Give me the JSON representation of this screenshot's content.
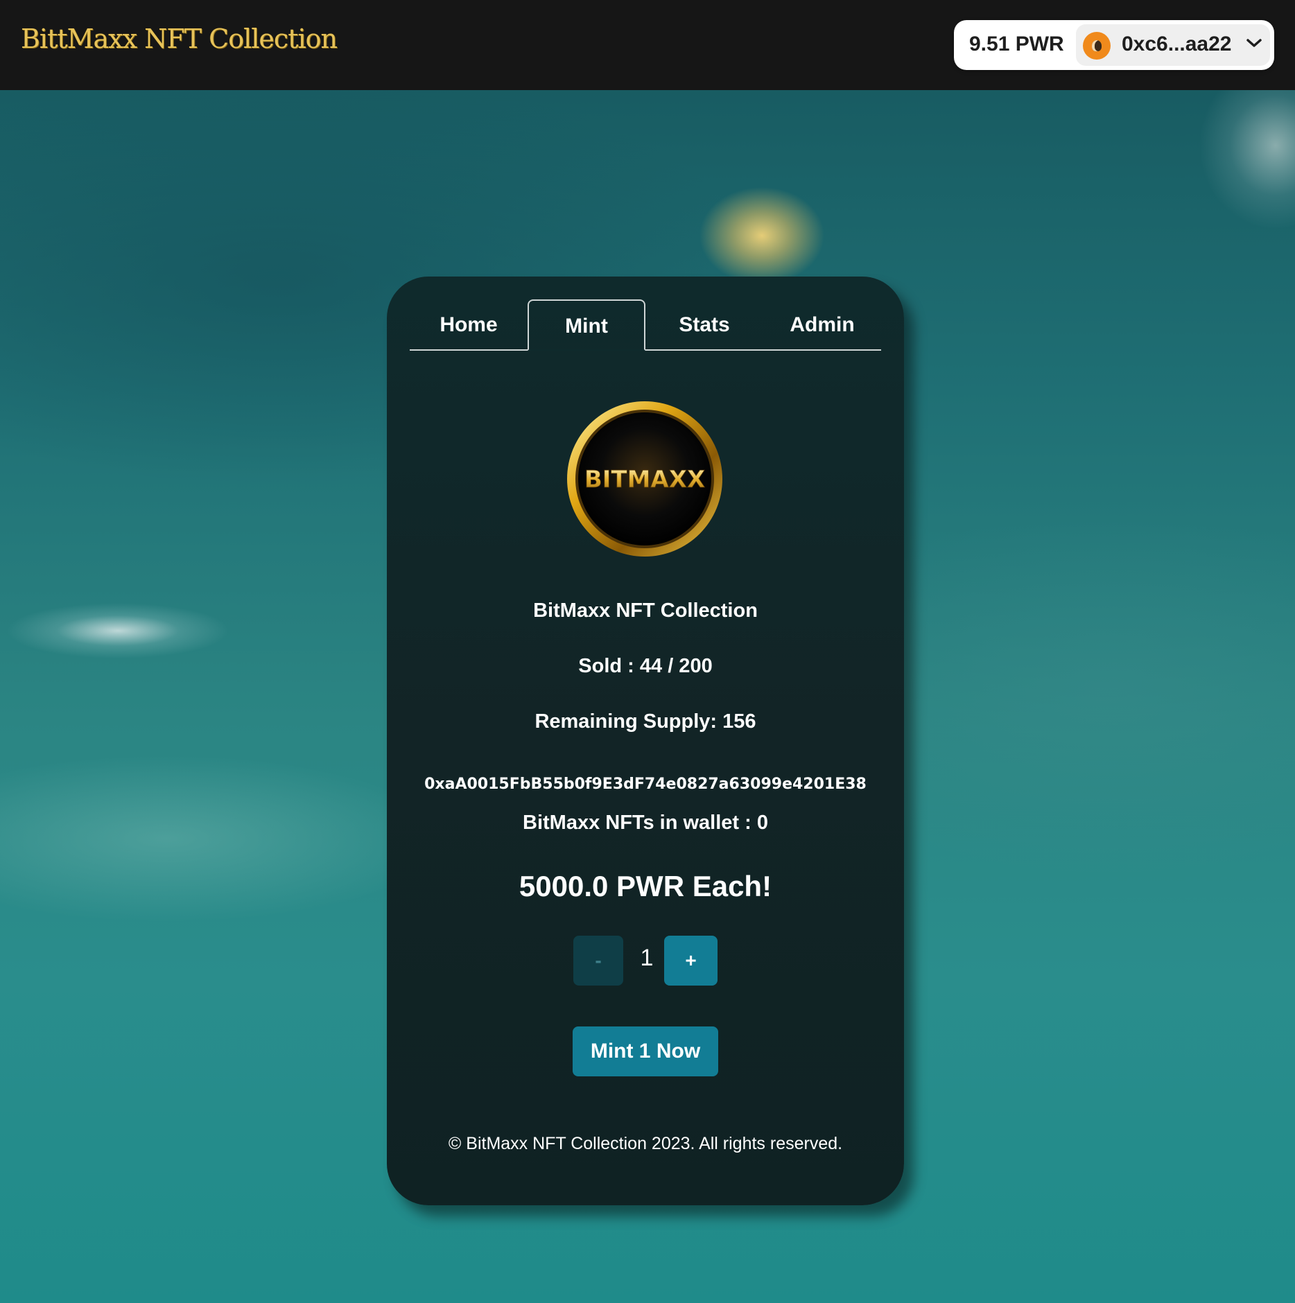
{
  "header": {
    "brand": "BittMaxx NFT Collection",
    "wallet": {
      "balance": "9.51 PWR",
      "address": "0xc6...aa22"
    }
  },
  "tabs": [
    {
      "label": "Home",
      "active": false
    },
    {
      "label": "Mint",
      "active": true
    },
    {
      "label": "Stats",
      "active": false
    },
    {
      "label": "Admin",
      "active": false
    }
  ],
  "mint": {
    "logo_text": "BITMAXX",
    "collection_name": "BitMaxx NFT Collection",
    "sold": "Sold : 44 / 200",
    "remaining": "Remaining Supply: 156",
    "contract_address": "0xaA0015FbB55b0f9E3dF74e0827a63099e4201E38",
    "in_wallet": "BitMaxx NFTs in wallet : 0",
    "price": "5000.0 PWR Each!",
    "decrement_label": "-",
    "quantity": "1",
    "increment_label": "+",
    "mint_button": "Mint 1 Now"
  },
  "footer": "© BitMaxx NFT Collection 2023. All rights reserved.",
  "colors": {
    "accent": "#127d95",
    "brand_gold": "#e7c35a",
    "card_bg": "#0f2a2c"
  }
}
